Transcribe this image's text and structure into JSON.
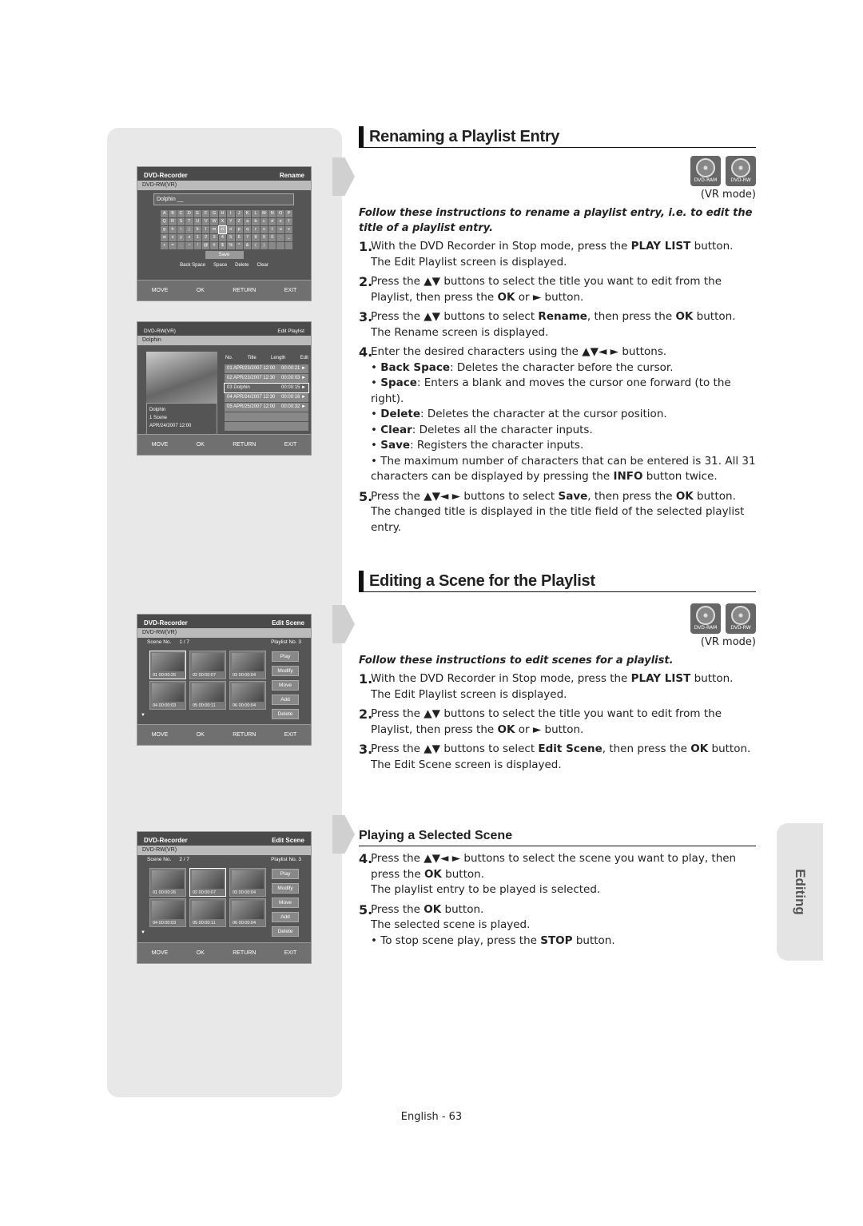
{
  "side_tab": "Editing",
  "page_number": "English - 63",
  "screens": {
    "footer": {
      "move": "MOVE",
      "ok": "OK",
      "return": "RETURN",
      "exit": "EXIT"
    },
    "rename": {
      "title": "DVD-Recorder",
      "mode": "Rename",
      "disc": "DVD-RW(VR)",
      "input": "Dolphin __",
      "keys": [
        "A",
        "B",
        "C",
        "D",
        "E",
        "F",
        "G",
        "H",
        "I",
        "J",
        "K",
        "L",
        "M",
        "N",
        "O",
        "P",
        "Q",
        "R",
        "S",
        "T",
        "U",
        "V",
        "W",
        "X",
        "Y",
        "Z",
        "a",
        "b",
        "c",
        "d",
        "e",
        "f",
        "g",
        "h",
        "i",
        "j",
        "k",
        "l",
        "m",
        "n",
        "o",
        "p",
        "q",
        "r",
        "s",
        "t",
        "u",
        "v",
        "w",
        "x",
        "y",
        "z",
        "1",
        "2",
        "3",
        "4",
        "5",
        "6",
        "7",
        "8",
        "9",
        "0",
        "-",
        "_",
        "+",
        "=",
        ".",
        "~",
        "!",
        "@",
        "#",
        "$",
        "%",
        "^",
        "&",
        "(",
        ")",
        "",
        "",
        ""
      ],
      "save": "Save",
      "hints": [
        "Back Space",
        "Space",
        "Delete",
        "Clear"
      ]
    },
    "playlist": {
      "disc": "DVD-RW(VR)",
      "mode": "Edit Playlist",
      "name": "Dolphin",
      "info": [
        "Dolphin",
        "1 Scene",
        "APR/24/2007 12:00"
      ],
      "cols": [
        "No.",
        "Title",
        "Length",
        "Edit"
      ],
      "rows": [
        {
          "title": "01 APR/23/2007 12:00",
          "length": "00:00:21"
        },
        {
          "title": "02 APR/23/2007 12:30",
          "length": "00:00:03"
        },
        {
          "title": "03 Dolphin",
          "length": "00:00:15"
        },
        {
          "title": "04 APR/24/2007 12:30",
          "length": "00:00:16"
        },
        {
          "title": "05 APR/25/2007 12:00",
          "length": "00:00:32"
        }
      ]
    },
    "scene": {
      "title": "DVD-Recorder",
      "mode": "Edit Scene",
      "disc": "DVD-RW(VR)",
      "scene_label": "Scene No.",
      "playlist_label": "Playlist No. 3",
      "scene_no_1": "1 / 7",
      "scene_no_2": "2 / 7",
      "thumbs": [
        "01  00:00:26",
        "02  00:00:07",
        "03  00:00:04",
        "04  00:00:03",
        "05  00:00:11",
        "06  00:00:04"
      ],
      "buttons": [
        "Play",
        "Modify",
        "Move",
        "Add",
        "Delete"
      ]
    }
  },
  "badges": [
    "DVD-RAM",
    "DVD-RW"
  ],
  "vr_mode": "(VR mode)",
  "s1": {
    "title": "Renaming a Playlist Entry",
    "intro": "Follow these instructions to rename a playlist entry, i.e. to edit the title of a playlist entry.",
    "steps": [
      {
        "n": "1.",
        "html": "With the DVD Recorder in Stop mode, press the <b>PLAY LIST</b> button.<br>The Edit Playlist screen is displayed."
      },
      {
        "n": "2.",
        "html": "Press the ▲▼ buttons to select the title you want to edit from the Playlist, then press the <b>OK</b> or ► button."
      },
      {
        "n": "3.",
        "html": "Press the ▲▼ buttons to select <b>Rename</b>, then press the <b>OK</b> button.<br>The Rename screen is displayed."
      },
      {
        "n": "4.",
        "html": "Enter the desired characters using the ▲▼◄ ► buttons.<br>• <b>Back Space</b>: Deletes the character before the cursor.<br>• <b>Space</b>: Enters a blank and moves the cursor one forward (to the right).<br>• <b>Delete</b>: Deletes the character at the cursor position.<br>• <b>Clear</b>: Deletes all the character inputs.<br>• <b>Save</b>: Registers the character inputs.<br>• The maximum number of characters that can be entered is 31. All 31 characters can be displayed by pressing the <b>INFO</b> button twice."
      },
      {
        "n": "5.",
        "html": "Press the ▲▼◄ ► buttons to select <b>Save</b>, then press the <b>OK</b> button.<br>The changed title is displayed in the title field of the selected playlist entry."
      }
    ]
  },
  "s2": {
    "title": "Editing a Scene for the Playlist",
    "intro": "Follow these instructions to edit scenes for a playlist.",
    "steps": [
      {
        "n": "1.",
        "html": "With the DVD Recorder in Stop mode, press the <b>PLAY LIST</b> button.<br>The Edit Playlist screen is displayed."
      },
      {
        "n": "2.",
        "html": "Press the ▲▼ buttons to select the title you want to edit from the Playlist, then press the <b>OK</b> or ► button."
      },
      {
        "n": "3.",
        "html": "Press the ▲▼ buttons to select <b>Edit Scene</b>, then press the <b>OK</b> button.<br>The Edit Scene screen is displayed."
      }
    ]
  },
  "s3": {
    "title": "Playing a Selected Scene",
    "steps": [
      {
        "n": "4.",
        "html": "Press the ▲▼◄ ► buttons to select the scene you want to play, then press the <b>OK</b> button.<br>The playlist entry to be played is selected."
      },
      {
        "n": "5.",
        "html": "Press the <b>OK</b> button.<br>The selected scene is played.<br>• To stop scene play, press the <b>STOP</b> button."
      }
    ]
  }
}
